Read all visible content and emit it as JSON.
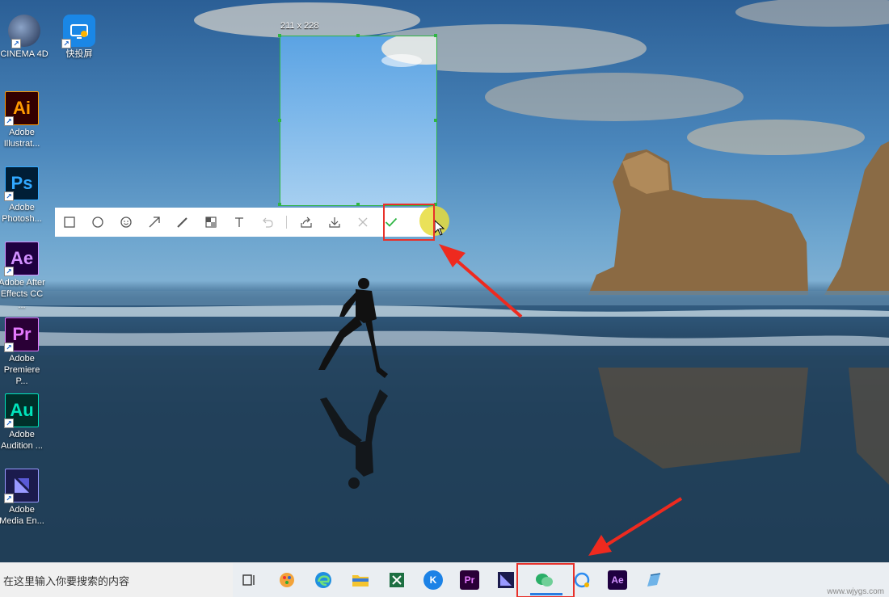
{
  "desktop_icons": [
    {
      "name": "cinema4d",
      "label": "CINEMA 4D",
      "glyph": ""
    },
    {
      "name": "kuaitoupin",
      "label": "快投屏",
      "glyph": ""
    },
    {
      "name": "adobe-illustrator",
      "label": "Adobe\nIllustrat...",
      "glyph": "Ai",
      "fg": "#ff9a00",
      "bg": "#330000"
    },
    {
      "name": "adobe-photoshop",
      "label": "Adobe\nPhotosh...",
      "glyph": "Ps",
      "fg": "#31a8ff",
      "bg": "#001e36"
    },
    {
      "name": "adobe-after-effects",
      "label": "Adobe After\nEffects CC ...",
      "glyph": "Ae",
      "fg": "#d291ff",
      "bg": "#1f0040"
    },
    {
      "name": "adobe-premiere",
      "label": "Adobe\nPremiere P...",
      "glyph": "Pr",
      "fg": "#e579ff",
      "bg": "#2a0036"
    },
    {
      "name": "adobe-audition",
      "label": "Adobe\nAudition ...",
      "glyph": "Au",
      "fg": "#00e4bb",
      "bg": "#00302a"
    },
    {
      "name": "adobe-media-encoder",
      "label": "Adobe\nMedia En...",
      "glyph": "",
      "fg": "#9999ff",
      "bg": "#1b1b4d"
    }
  ],
  "capture": {
    "size_label": "211 x 228"
  },
  "toolbar": {
    "tools": [
      {
        "name": "rectangle-tool",
        "icon": "rectangle-icon"
      },
      {
        "name": "ellipse-tool",
        "icon": "circle-icon"
      },
      {
        "name": "emoji-tool",
        "icon": "smiley-icon"
      },
      {
        "name": "arrow-tool",
        "icon": "arrow-icon"
      },
      {
        "name": "pen-tool",
        "icon": "pencil-icon"
      },
      {
        "name": "mosaic-tool",
        "icon": "mosaic-icon"
      },
      {
        "name": "text-tool",
        "icon": "text-icon"
      },
      {
        "name": "undo-button",
        "icon": "undo-icon"
      },
      {
        "name": "share-button",
        "icon": "share-icon"
      },
      {
        "name": "download-button",
        "icon": "download-icon"
      },
      {
        "name": "cancel-button",
        "icon": "close-icon"
      },
      {
        "name": "confirm-button",
        "icon": "check-icon"
      }
    ]
  },
  "taskbar": {
    "search_placeholder": "在这里输入你要搜索的内容",
    "items": [
      {
        "name": "task-view",
        "icon": "task-view-icon"
      },
      {
        "name": "app-paint",
        "icon": "paint-icon"
      },
      {
        "name": "app-edge",
        "icon": "edge-icon"
      },
      {
        "name": "app-file-explorer",
        "icon": "folder-icon"
      },
      {
        "name": "app-excel",
        "icon": "excel-icon"
      },
      {
        "name": "app-kugou",
        "icon": "kugou-icon",
        "glyph": "K"
      },
      {
        "name": "app-premiere",
        "icon": "premiere-icon",
        "glyph": "Pr"
      },
      {
        "name": "app-media-encoder",
        "icon": "media-encoder-icon"
      },
      {
        "name": "app-wechat",
        "icon": "wechat-icon"
      },
      {
        "name": "app-capture",
        "icon": "capture-icon"
      },
      {
        "name": "app-after-effects",
        "icon": "after-effects-icon",
        "glyph": "Ae"
      },
      {
        "name": "app-notes",
        "icon": "notes-icon"
      }
    ]
  },
  "watermark": "www.wjygs.com",
  "colors": {
    "selection_border": "#2fb544",
    "highlight": "#e8312a",
    "confirm": "#2fb544"
  }
}
